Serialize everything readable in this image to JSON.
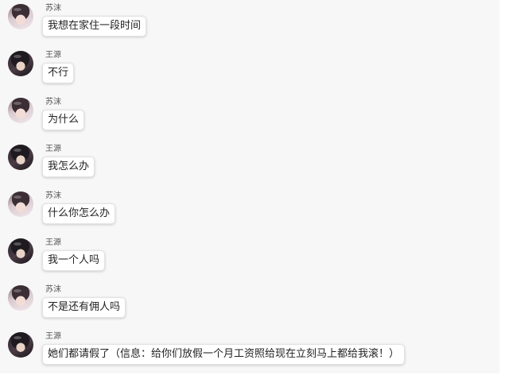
{
  "messages": [
    {
      "sender": "苏沫",
      "text": "我想在家住一段时间",
      "avatar": "female-avatar"
    },
    {
      "sender": "王源",
      "text": "不行",
      "avatar": "male-avatar"
    },
    {
      "sender": "苏沫",
      "text": "为什么",
      "avatar": "female-avatar"
    },
    {
      "sender": "王源",
      "text": "我怎么办",
      "avatar": "male-avatar"
    },
    {
      "sender": "苏沫",
      "text": "什么你怎么办",
      "avatar": "female-avatar"
    },
    {
      "sender": "王源",
      "text": "我一个人吗",
      "avatar": "male-avatar"
    },
    {
      "sender": "苏沫",
      "text": "不是还有佣人吗",
      "avatar": "female-avatar"
    },
    {
      "sender": "王源",
      "text": "她们都请假了（信息：给你们放假一个月工资照给现在立刻马上都给我滚！）",
      "avatar": "male-avatar"
    }
  ],
  "colors": {
    "panel_background": "#f7f7f7",
    "bubble_background": "#ffffff",
    "text": "#222222",
    "sender_text": "#555555"
  }
}
